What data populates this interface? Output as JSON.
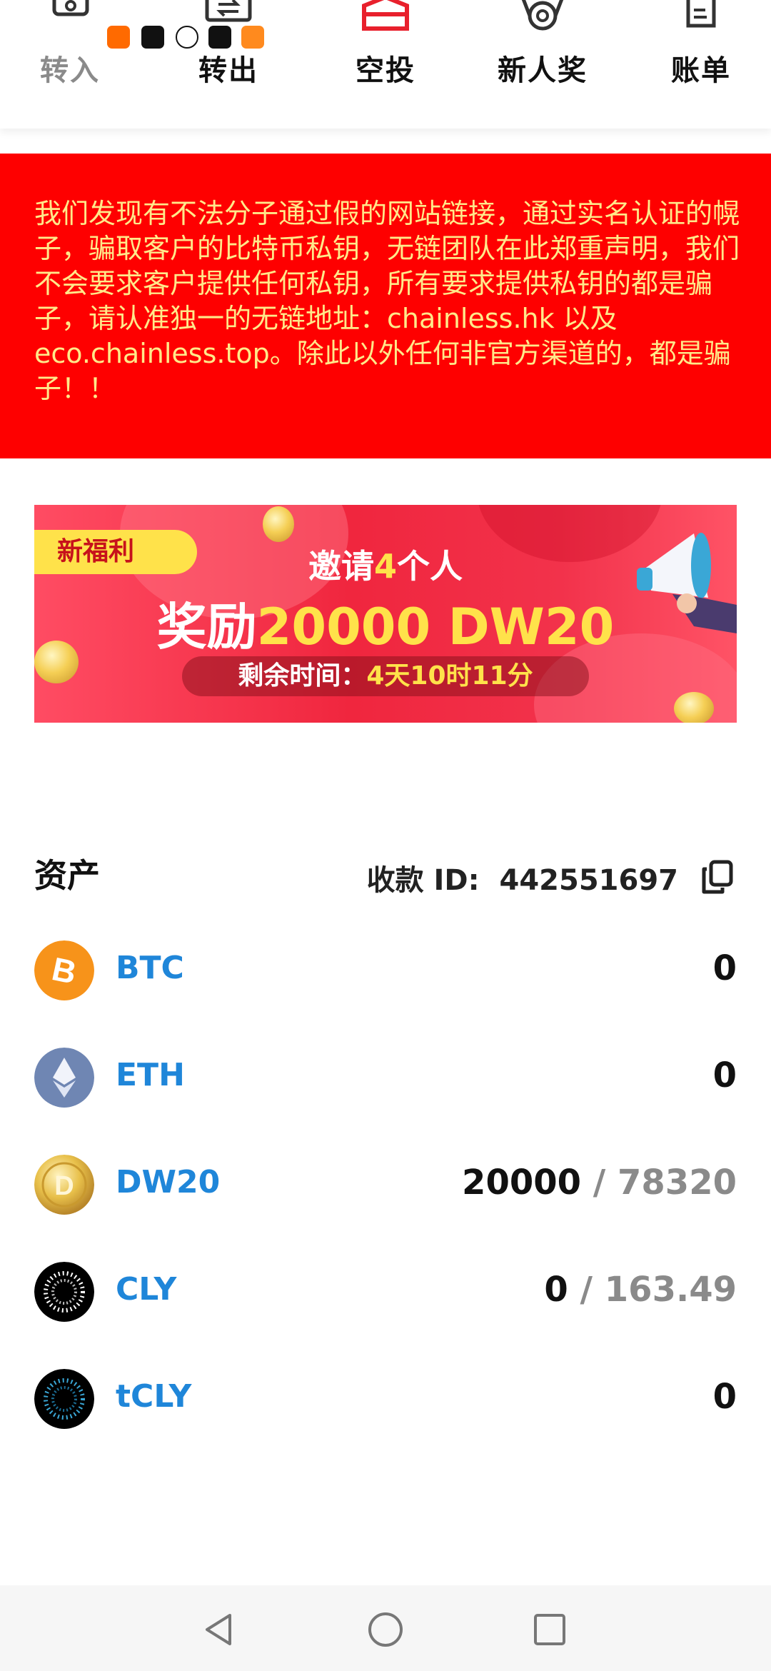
{
  "nav": {
    "items": [
      {
        "label": "转入",
        "icon": "deposit-icon"
      },
      {
        "label": "转出",
        "icon": "transfer-out-icon"
      },
      {
        "label": "空投",
        "icon": "airdrop-gift-icon"
      },
      {
        "label": "新人奖",
        "icon": "newcomer-medal-icon"
      },
      {
        "label": "账单",
        "icon": "bill-icon"
      }
    ]
  },
  "warning": {
    "text": "我们发现有不法分子通过假的网站链接，通过实名认证的幌子，骗取客户的比特币私钥，无链团队在此郑重声明，我们不会要求客户提供任何私钥，所有要求提供私钥的都是骗子，请认准独一的无链地址：chainless.hk 以及 eco.chainless.top。除此以外任何非官方渠道的，都是骗子！！"
  },
  "banner": {
    "badge": "新福利",
    "line1_pre": "邀请",
    "line1_num": "4",
    "line1_post": "个人",
    "line2_pre": "奖励",
    "line2_amount": "20000 DW20",
    "countdown_label": "剩余时间：",
    "countdown_value": "4天10时11分"
  },
  "assets": {
    "title": "资产",
    "receive_id_label": "收款 ID:",
    "receive_id": "442551697",
    "list": [
      {
        "name": "BTC",
        "amount": "0",
        "total": "",
        "icon": "bitcoin-icon",
        "color": "#f7931a"
      },
      {
        "name": "ETH",
        "amount": "0",
        "total": "",
        "icon": "ethereum-icon",
        "color": "#6f86b3"
      },
      {
        "name": "DW20",
        "amount": "20000",
        "total": " / 78320",
        "icon": "dw20-coin-icon",
        "color": "#e8c04a"
      },
      {
        "name": "CLY",
        "amount": "0",
        "total": " / 163.49",
        "icon": "cly-token-icon",
        "color": "#000000"
      },
      {
        "name": "tCLY",
        "amount": "0",
        "total": "",
        "icon": "tcly-token-icon",
        "color": "#000000"
      }
    ]
  },
  "colors": {
    "warning_bg": "#fe0000",
    "warning_text": "#ffe98a",
    "asset_name": "#1f86d9",
    "accent_yellow": "#ffe24a"
  }
}
